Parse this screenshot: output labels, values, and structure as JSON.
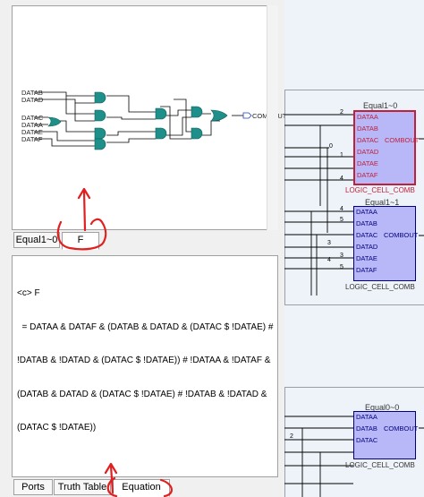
{
  "schematic": {
    "inputs": [
      "DATAB",
      "DATAD",
      "DATAC",
      "DATAA",
      "DATAE",
      "DATAF"
    ],
    "output": "COMBOUT"
  },
  "top_tabs": [
    {
      "label": "Equal1~0",
      "active": false
    },
    {
      "label": "F",
      "active": true
    }
  ],
  "equation": {
    "lines": [
      "<c> F",
      "  = DATAA & DATAF & (DATAB & DATAD & (DATAC $ !DATAE) #",
      "!DATAB & !DATAD & (DATAC $ !DATAE)) # !DATAA & !DATAF &",
      "(DATAB & DATAD & (DATAC $ !DATAE) # !DATAB & !DATAD &",
      "(DATAC $ !DATAE))"
    ]
  },
  "bottom_tabs": [
    {
      "label": "Ports",
      "active": false
    },
    {
      "label": "Truth Table",
      "active": false
    },
    {
      "label": "Equation",
      "active": true
    }
  ],
  "right_view": {
    "cells": [
      {
        "title": "Equal1~0",
        "type_label": "LOGIC_CELL_COMB",
        "ports": [
          "DATAA",
          "DATAB",
          "DATAC",
          "DATAD",
          "DATAE",
          "DATAF"
        ],
        "output": "COMBOUT",
        "pin_numbers": [
          "2",
          "0",
          "1",
          "4"
        ],
        "selected": true
      },
      {
        "title": "Equal1~1",
        "type_label": "LOGIC_CELL_COMB",
        "ports": [
          "DATAA",
          "DATAB",
          "DATAC",
          "DATAD",
          "DATAE",
          "DATAF"
        ],
        "output": "COMBOUT",
        "pin_numbers": [
          "4",
          "5",
          "3",
          "3",
          "4",
          "5"
        ],
        "selected": false
      },
      {
        "title": "Equal0~0",
        "type_label": "LOGIC_CELL_COMB",
        "ports": [
          "DATAA",
          "DATAB",
          "DATAC"
        ],
        "output": "COMBOUT",
        "pin_numbers": [
          "2"
        ],
        "selected": false
      }
    ],
    "colors": {
      "selected_border": "#c0203a",
      "cell_fill": "#b8b8f8",
      "cell_border": "#000080",
      "background": "#eef3f9"
    }
  }
}
